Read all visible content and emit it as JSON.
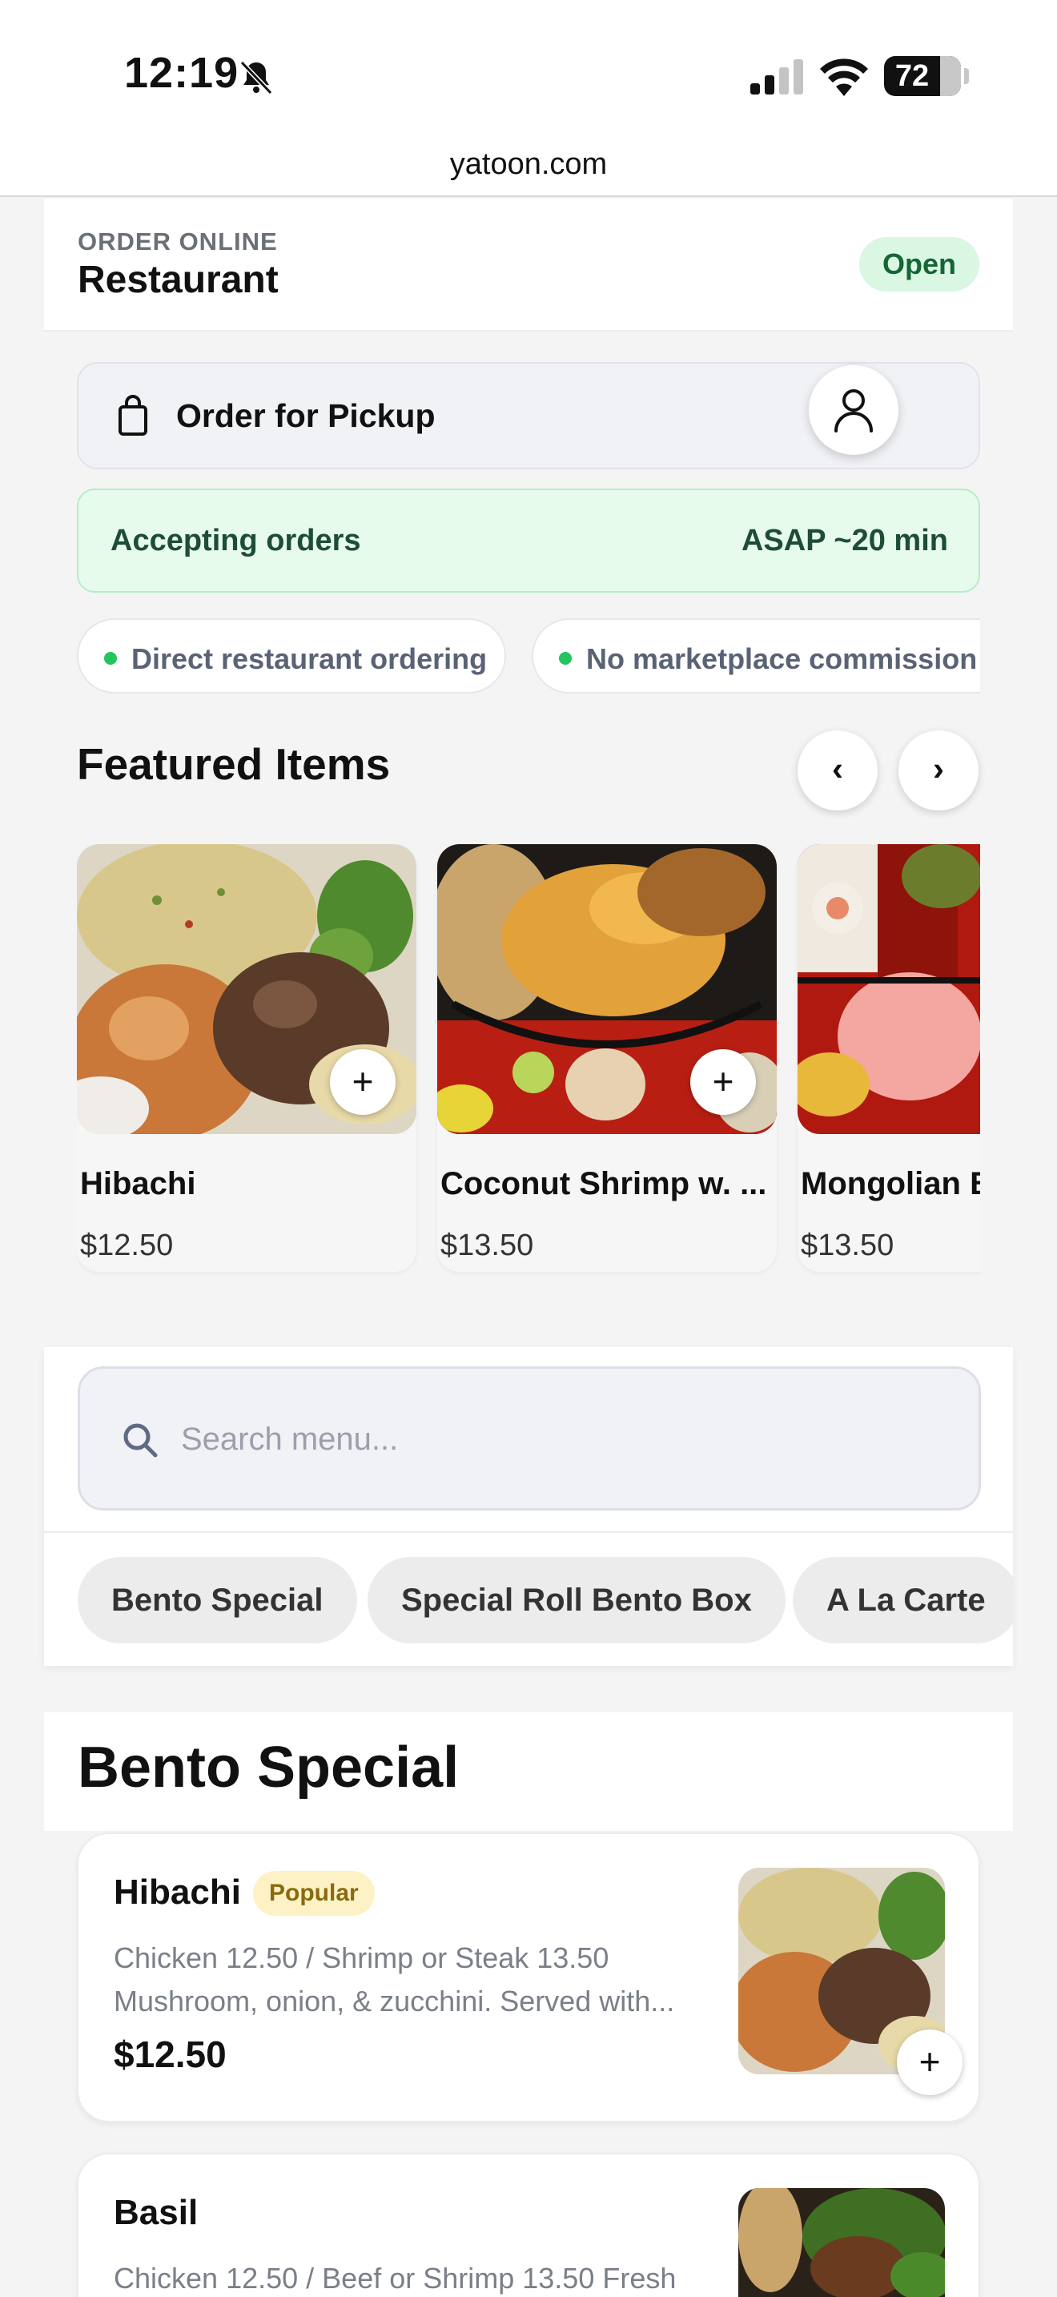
{
  "status_bar": {
    "time": "12:19",
    "battery": "72"
  },
  "url_bar": {
    "url": "yatoon.com"
  },
  "header": {
    "eyebrow": "ORDER ONLINE",
    "title": "Restaurant",
    "status_badge": "Open"
  },
  "pickup": {
    "label": "Order for Pickup",
    "icon": "bag-icon",
    "account_icon": "user-icon"
  },
  "accepting": {
    "label": "Accepting orders",
    "eta": "ASAP ~20 min"
  },
  "info_chips": [
    {
      "label": "Direct restaurant ordering"
    },
    {
      "label": "No marketplace commission"
    }
  ],
  "featured": {
    "title": "Featured Items",
    "prev_label": "‹",
    "next_label": "›",
    "items": [
      {
        "name": "Hibachi",
        "price": "$12.50"
      },
      {
        "name": "Coconut Shrimp w. ...",
        "price": "$13.50"
      },
      {
        "name": "Mongolian B",
        "price": "$13.50"
      }
    ]
  },
  "search": {
    "placeholder": "Search menu..."
  },
  "categories": [
    {
      "label": "Bento Special"
    },
    {
      "label": "Special Roll Bento Box"
    },
    {
      "label": "A La Carte"
    }
  ],
  "section": {
    "title": "Bento Special"
  },
  "menu_items": [
    {
      "name": "Hibachi",
      "badge": "Popular",
      "description": "Chicken 12.50 / Shrimp or Steak 13.50 Mushroom, onion, & zucchini. Served with...",
      "price": "$12.50"
    },
    {
      "name": "Basil",
      "description": "Chicken 12.50 / Beef or Shrimp 13.50 Fresh"
    }
  ],
  "colors": {
    "accent_green": "#22c55e",
    "open_badge_bg": "#d9f7e3",
    "accepting_bg": "#e6fbec",
    "popular_badge_bg": "#fdf2c6"
  }
}
